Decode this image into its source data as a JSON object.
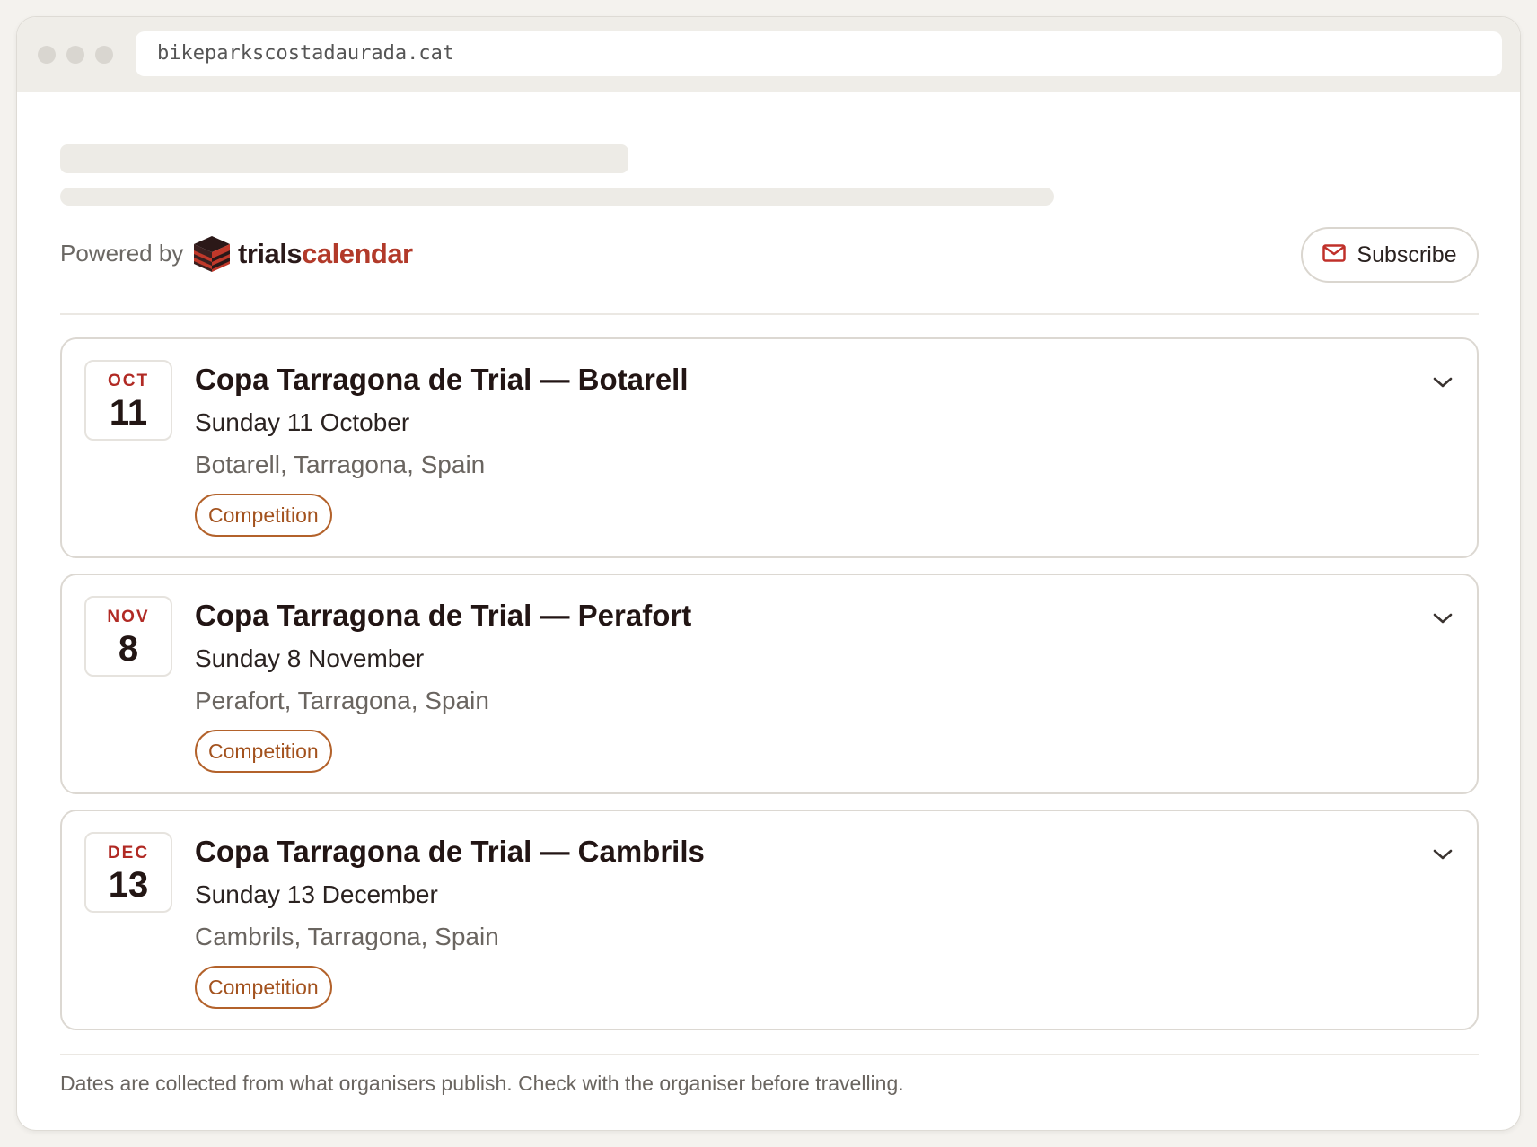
{
  "browser": {
    "url": "bikeparkscostadaurada.cat"
  },
  "widget": {
    "powered_by": "Powered by",
    "brand_part1": "trials",
    "brand_part2": "calendar",
    "subscribe_label": "Subscribe",
    "icons": {
      "mail": "mail-icon",
      "logo": "trialscalendar-logo-icon",
      "expand": "chevron-down-icon"
    },
    "colors": {
      "accent_red": "#b12a24",
      "tag_orange": "#a3521e",
      "brand_red": "#b23a2a"
    }
  },
  "events": [
    {
      "month": "OCT",
      "day": "11",
      "title": "Copa Tarragona de Trial — Botarell",
      "date": "Sunday 11 October",
      "location": "Botarell, Tarragona, Spain",
      "tag": "Competition"
    },
    {
      "month": "NOV",
      "day": "8",
      "title": "Copa Tarragona de Trial — Perafort",
      "date": "Sunday 8 November",
      "location": "Perafort, Tarragona, Spain",
      "tag": "Competition"
    },
    {
      "month": "DEC",
      "day": "13",
      "title": "Copa Tarragona de Trial — Cambrils",
      "date": "Sunday 13 December",
      "location": "Cambrils, Tarragona, Spain",
      "tag": "Competition"
    }
  ],
  "footer": {
    "note": "Dates are collected from what organisers publish. Check with the organiser before travelling."
  }
}
